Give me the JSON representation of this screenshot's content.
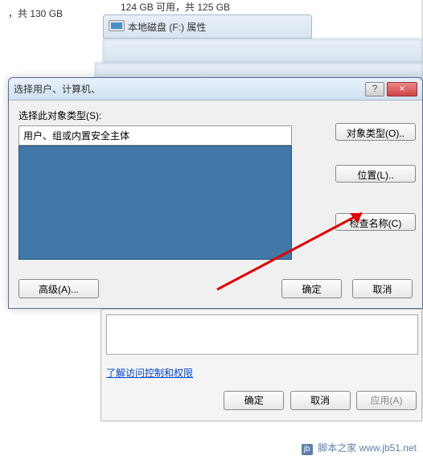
{
  "bg": {
    "total": "，共 130 GB",
    "drive_free": "124 GB 可用，共 125 GB",
    "drive_title": "本地磁盘 (F:) 属性"
  },
  "dialog": {
    "title": "选择用户、计算机、",
    "help": "?",
    "close": "×",
    "object_type_label": "选择此对象类型(S):",
    "object_type_value": "用户、组或内置安全主体",
    "btn_object_types": "对象类型(O)..",
    "btn_locations": "位置(L)..",
    "btn_check_names": "检查名称(C)",
    "btn_advanced": "高级(A)...",
    "btn_ok": "确定",
    "btn_cancel": "取消"
  },
  "lower": {
    "link": "了解访问控制和权限",
    "btn_ok": "确定",
    "btn_cancel": "取消",
    "btn_apply": "应用(A)"
  },
  "watermark": {
    "icon": "jb",
    "text": "脚本之家 www.jb51.net"
  }
}
